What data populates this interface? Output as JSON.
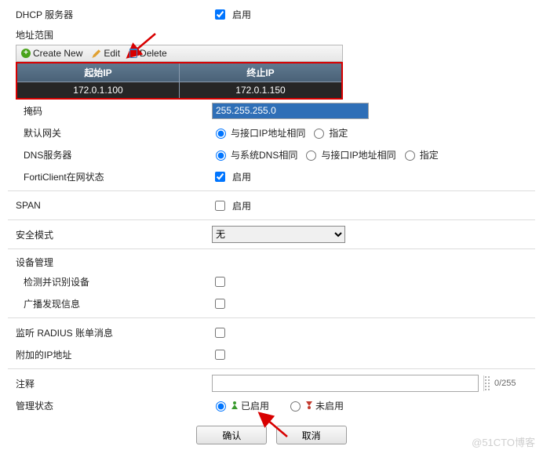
{
  "dhcp": {
    "label": "DHCP 服务器",
    "enable_checked": true,
    "enable_label": "启用",
    "range_title": "地址范围",
    "toolbar": {
      "create": "Create New",
      "edit": "Edit",
      "delete": "Delete"
    },
    "table": {
      "start_header": "起始IP",
      "end_header": "终止IP",
      "start_value": "172.0.1.100",
      "end_value": "172.0.1.150"
    },
    "netmask_label": "掩码",
    "netmask_value": "255.255.255.0",
    "gateway_label": "默认网关",
    "gateway_options": {
      "same": "与接口IP地址相同",
      "specify": "指定"
    },
    "gateway_selected": "same",
    "dns_label": "DNS服务器",
    "dns_options": {
      "system": "与系统DNS相同",
      "same": "与接口IP地址相同",
      "specify": "指定"
    },
    "dns_selected": "system",
    "forticlient_label": "FortiClient在网状态",
    "forticlient_checked": true,
    "forticlient_text": "启用"
  },
  "span": {
    "label": "SPAN",
    "checked": false,
    "text": "启用"
  },
  "security_mode": {
    "label": "安全模式",
    "value": "无"
  },
  "device_mgmt": {
    "title": "设备管理",
    "detect_label": "检测并识别设备",
    "detect_checked": false,
    "broadcast_label": "广播发现信息",
    "broadcast_checked": false
  },
  "radius": {
    "label": "监听 RADIUS 账单消息",
    "checked": false
  },
  "secondary_ip": {
    "label": "附加的IP地址",
    "checked": false
  },
  "comment": {
    "label": "注释",
    "value": "",
    "counter": "0/255"
  },
  "admin_status": {
    "label": "管理状态",
    "options": {
      "up": "已启用",
      "down": "未启用"
    },
    "selected": "up"
  },
  "buttons": {
    "ok": "确认",
    "cancel": "取消"
  },
  "watermark": "@51CTO博客"
}
